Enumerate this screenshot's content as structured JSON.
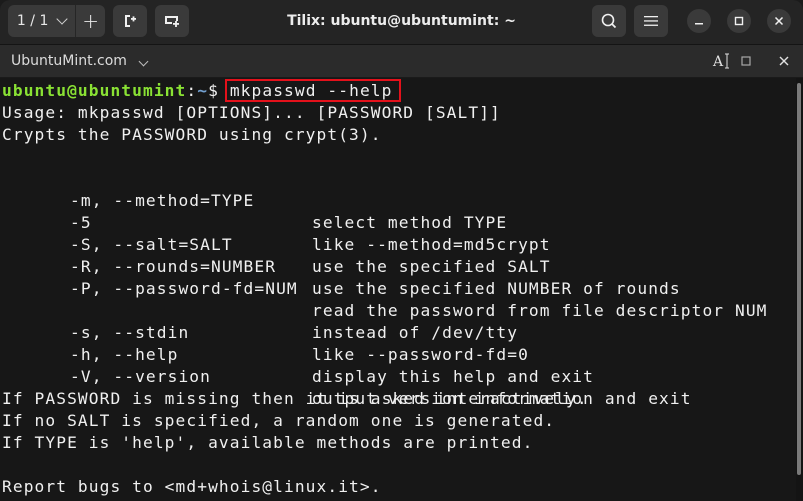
{
  "headerbar": {
    "session_label": "1 / 1",
    "add_session_label": "+",
    "title": "Tilix: ubuntu@ubuntumint: ~",
    "icons": {
      "session_dropdown": "chevron-down-icon",
      "add_terminal_right": "split-right-icon",
      "add_terminal_down": "split-down-icon",
      "search": "search-icon",
      "menu": "hamburger-menu-icon",
      "minimize": "minimize-icon",
      "maximize": "maximize-icon",
      "close": "close-icon"
    }
  },
  "tabbar": {
    "title": "UbuntuMint.com",
    "icons": {
      "title_dropdown": "chevron-down-icon",
      "read_only": "text-cursor-icon",
      "maximize_terminal": "square-icon",
      "close_terminal": "close-icon"
    }
  },
  "terminal": {
    "prompt": {
      "user_host": "ubuntu@ubuntumint",
      "colon": ":",
      "path": "~",
      "dollar": "$ ",
      "command": "mkpasswd --help"
    },
    "usage_line": "Usage: mkpasswd [OPTIONS]... [PASSWORD [SALT]]",
    "description_line": "Crypts the PASSWORD using crypt(3).",
    "options": [
      {
        "flag": "-m, --method=TYPE",
        "desc": "select method TYPE"
      },
      {
        "flag": "-5",
        "desc": "like --method=md5crypt"
      },
      {
        "flag": "-S, --salt=SALT",
        "desc": "use the specified SALT"
      },
      {
        "flag": "-R, --rounds=NUMBER",
        "desc": "use the specified NUMBER of rounds"
      },
      {
        "flag": "-P, --password-fd=NUM",
        "desc": "read the password from file descriptor NUM"
      },
      {
        "flag": "",
        "desc": "instead of /dev/tty"
      },
      {
        "flag": "-s, --stdin",
        "desc": "like --password-fd=0"
      },
      {
        "flag": "-h, --help",
        "desc": "display this help and exit"
      },
      {
        "flag": "-V, --version",
        "desc": "output version information and exit"
      }
    ],
    "notes": [
      "If PASSWORD is missing then it is asked interactively.",
      "If no SALT is specified, a random one is generated.",
      "If TYPE is 'help', available methods are printed."
    ],
    "report_line": "Report bugs to <md+whois@linux.it>."
  },
  "colors": {
    "prompt_user": "#8ae234",
    "prompt_path": "#729fcf",
    "highlight_box": "#e4111b",
    "terminal_bg": "#171717",
    "text": "#f0f0f0"
  }
}
